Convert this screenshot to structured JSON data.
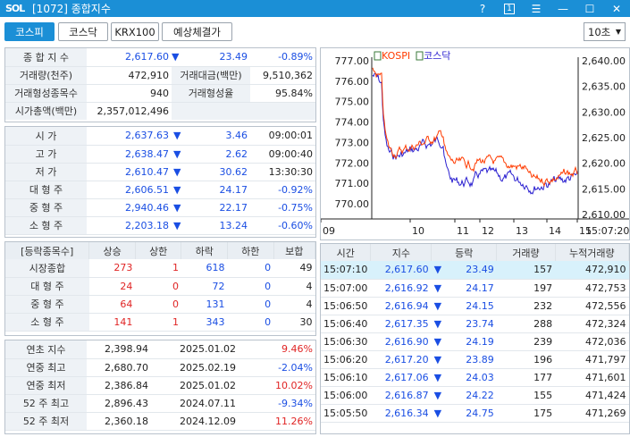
{
  "window": {
    "logo": "SOL",
    "title": "[1072] 종합지수",
    "help": "?",
    "num_btn": "1",
    "menu": "☰",
    "minimize": "—",
    "maximize": "☐",
    "close": "✕"
  },
  "tabs": [
    {
      "label": "코스피",
      "active": true
    },
    {
      "label": "코스닥",
      "active": false
    },
    {
      "label": "KRX100",
      "active": false
    },
    {
      "label": "예상체결가",
      "active": false
    }
  ],
  "interval": {
    "value": "10초",
    "arrow": "▼"
  },
  "summary": {
    "index_label": "종 합 지 수",
    "index_value": "2,617.60",
    "change_arrow": "▼",
    "change": "23.49",
    "change_pct": "-0.89%",
    "volume_label": "거래량(천주)",
    "volume": "472,910",
    "amount_label": "거래대금(백만)",
    "amount": "9,510,362",
    "formed_count_label": "거래형성종목수",
    "formed_count": "940",
    "formed_rate_label": "거래형성율",
    "formed_rate": "95.84%",
    "mcap_label": "시가총액(백만)",
    "mcap": "2,357,012,496"
  },
  "ohlc": [
    {
      "label": "시    가",
      "value": "2,637.63",
      "arrow": "▼",
      "change": "3.46",
      "extra": "09:00:01",
      "extra_color": "#222"
    },
    {
      "label": "고    가",
      "value": "2,638.47",
      "arrow": "▼",
      "change": "2.62",
      "extra": "09:00:40",
      "extra_color": "#222"
    },
    {
      "label": "저    가",
      "value": "2,610.47",
      "arrow": "▼",
      "change": "30.62",
      "extra": "13:30:30",
      "extra_color": "#222"
    },
    {
      "label": "대 형 주",
      "value": "2,606.51",
      "arrow": "▼",
      "change": "24.17",
      "extra": "-0.92%",
      "extra_color": "#1a4ee3"
    },
    {
      "label": "중 형 주",
      "value": "2,940.46",
      "arrow": "▼",
      "change": "22.17",
      "extra": "-0.75%",
      "extra_color": "#1a4ee3"
    },
    {
      "label": "소 형 주",
      "value": "2,203.18",
      "arrow": "▼",
      "change": "13.24",
      "extra": "-0.60%",
      "extra_color": "#1a4ee3"
    }
  ],
  "breadth": {
    "headers": [
      "[등락종목수]",
      "상승",
      "상한",
      "하락",
      "하한",
      "보합"
    ],
    "rows": [
      {
        "label": "시장종합",
        "up": "273",
        "limit_up": "1",
        "down": "618",
        "limit_down": "0",
        "flat": "49"
      },
      {
        "label": "대 형 주",
        "up": "24",
        "limit_up": "0",
        "down": "72",
        "limit_down": "0",
        "flat": "4"
      },
      {
        "label": "중 형 주",
        "up": "64",
        "limit_up": "0",
        "down": "131",
        "limit_down": "0",
        "flat": "4"
      },
      {
        "label": "소 형 주",
        "up": "141",
        "limit_up": "1",
        "down": "343",
        "limit_down": "0",
        "flat": "30"
      }
    ]
  },
  "yearly": [
    {
      "label": "연초  지수",
      "value": "2,398.94",
      "date": "2025.01.02",
      "pct": "9.46%",
      "pct_color": "#e02424"
    },
    {
      "label": "연중  최고",
      "value": "2,680.70",
      "date": "2025.02.19",
      "pct": "-2.04%",
      "pct_color": "#1a4ee3"
    },
    {
      "label": "연중  최저",
      "value": "2,386.84",
      "date": "2025.01.02",
      "pct": "10.02%",
      "pct_color": "#e02424"
    },
    {
      "label": "52 주 최고",
      "value": "2,896.43",
      "date": "2024.07.11",
      "pct": "-9.34%",
      "pct_color": "#1a4ee3"
    },
    {
      "label": "52 주 최저",
      "value": "2,360.18",
      "date": "2024.12.09",
      "pct": "11.26%",
      "pct_color": "#e02424"
    }
  ],
  "ticks": {
    "headers": [
      "시간",
      "지수",
      "등락",
      "거래량",
      "누적거래량"
    ],
    "rows": [
      {
        "time": "15:07:10",
        "index": "2,617.60",
        "arrow": "▼",
        "change": "23.49",
        "vol": "157",
        "cum": "472,910"
      },
      {
        "time": "15:07:00",
        "index": "2,616.92",
        "arrow": "▼",
        "change": "24.17",
        "vol": "197",
        "cum": "472,753"
      },
      {
        "time": "15:06:50",
        "index": "2,616.94",
        "arrow": "▼",
        "change": "24.15",
        "vol": "232",
        "cum": "472,556"
      },
      {
        "time": "15:06:40",
        "index": "2,617.35",
        "arrow": "▼",
        "change": "23.74",
        "vol": "288",
        "cum": "472,324"
      },
      {
        "time": "15:06:30",
        "index": "2,616.90",
        "arrow": "▼",
        "change": "24.19",
        "vol": "239",
        "cum": "472,036"
      },
      {
        "time": "15:06:20",
        "index": "2,617.20",
        "arrow": "▼",
        "change": "23.89",
        "vol": "196",
        "cum": "471,797"
      },
      {
        "time": "15:06:10",
        "index": "2,617.06",
        "arrow": "▼",
        "change": "24.03",
        "vol": "177",
        "cum": "471,601"
      },
      {
        "time": "15:06:00",
        "index": "2,616.87",
        "arrow": "▼",
        "change": "24.22",
        "vol": "155",
        "cum": "471,424"
      },
      {
        "time": "15:05:50",
        "index": "2,616.34",
        "arrow": "▼",
        "change": "24.75",
        "vol": "175",
        "cum": "471,269"
      }
    ]
  },
  "chart": {
    "legend_kospi": "KOSPI",
    "legend_kosdaq": "코스닥",
    "left_ticks": [
      "777.00",
      "776.00",
      "775.00",
      "774.00",
      "773.00",
      "772.00",
      "771.00",
      "770.00"
    ],
    "right_ticks": [
      "2,640.00",
      "2,635.00",
      "2,630.00",
      "2,625.00",
      "2,620.00",
      "2,615.00",
      "2,610.00"
    ],
    "x_ticks": [
      "09",
      "10",
      "11",
      "12",
      "13",
      "14",
      "15"
    ],
    "x_end": "15:07:20",
    "colors": {
      "kospi": "#ff3b00",
      "kosdaq": "#2a1fd0"
    }
  }
}
